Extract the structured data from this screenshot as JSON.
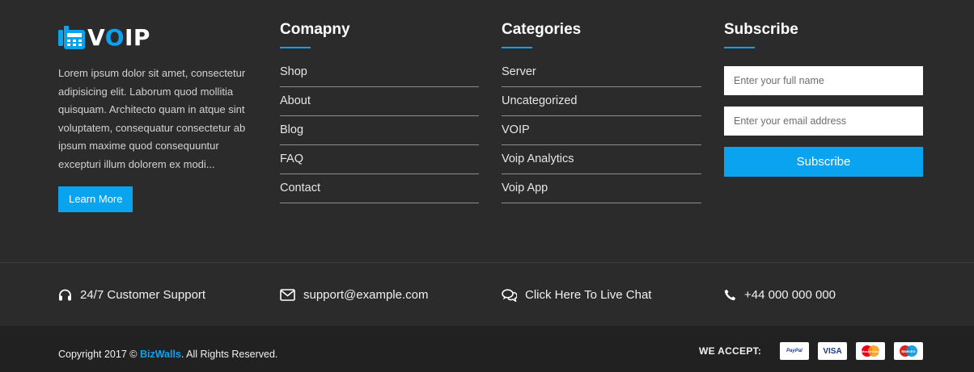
{
  "logo": {
    "text_prefix": "V",
    "text_o": "O",
    "text_suffix": "IP",
    "accent_color": "#0aa3f0"
  },
  "about": {
    "text": "Lorem ipsum dolor sit amet, consectetur adipisicing elit. Laborum quod mollitia quisquam. Architecto quam in atque sint voluptatem, consequatur consectetur ab ipsum maxime quod consequuntur excepturi illum dolorem ex modi...",
    "learn_more": "Learn More"
  },
  "company": {
    "title": "Comapny",
    "links": [
      "Shop",
      "About",
      "Blog",
      "FAQ",
      "Contact"
    ]
  },
  "categories": {
    "title": "Categories",
    "links": [
      "Server",
      "Uncategorized",
      "VOIP",
      "Voip Analytics",
      "Voip App"
    ]
  },
  "subscribe": {
    "title": "Subscribe",
    "name_placeholder": "Enter your full name",
    "email_placeholder": "Enter your email address",
    "button": "Subscribe"
  },
  "info": {
    "support": "24/7 Customer Support",
    "email": "support@example.com",
    "chat": "Click Here To Live Chat",
    "phone": "+44 000 000 000"
  },
  "footer": {
    "copyright_prefix": "Copyright 2017 © ",
    "brand": "BizWalls",
    "copyright_suffix": ". All Rights Reserved.",
    "we_accept": "WE ACCEPT:",
    "cards": {
      "paypal": "PayPal",
      "visa": "VISA",
      "mastercard": "MasterCard",
      "maestro": "Maestro"
    }
  }
}
